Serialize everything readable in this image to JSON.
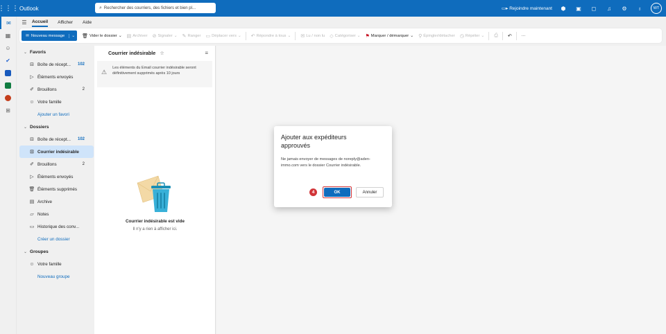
{
  "app": {
    "name": "Outlook"
  },
  "search": {
    "placeholder": "Rechercher des courriers, des fichiers et bien pl..."
  },
  "topbar": {
    "join_label": "Rejoindre maintenant",
    "avatar_initials": "WT"
  },
  "tabs": [
    {
      "label": "Accueil",
      "active": true
    },
    {
      "label": "Afficher",
      "active": false
    },
    {
      "label": "Aide",
      "active": false
    }
  ],
  "ribbon": {
    "new_message": "Nouveau message",
    "empty_folder": "Vider le dossier",
    "archive": "Archiver",
    "report": "Signaler",
    "sweep": "Ranger",
    "move_to": "Déplacer vers",
    "reply_all": "Répondre à tous",
    "read_unread": "Lu / non lu",
    "categorize": "Catégoriser",
    "flag": "Marquer / démarquer",
    "pin": "Épingler/détacher",
    "snooze": "Répéter",
    "more": "···"
  },
  "folders": {
    "favorites_title": "Favoris",
    "favorites": [
      {
        "label": "Boîte de récept...",
        "count": "102",
        "count_style": "blue",
        "icon": "inbox-icon"
      },
      {
        "label": "Éléments envoyés",
        "count": "",
        "icon": "send-icon"
      },
      {
        "label": "Brouillons",
        "count": "2",
        "count_style": "gray",
        "icon": "draft-icon"
      },
      {
        "label": "Votre famille",
        "count": "",
        "icon": "group-icon"
      }
    ],
    "add_favorite": "Ajouter un favori",
    "folders_title": "Dossiers",
    "items": [
      {
        "label": "Boîte de récept...",
        "count": "102",
        "count_style": "blue",
        "icon": "inbox-icon"
      },
      {
        "label": "Courrier indésirable",
        "count": "",
        "icon": "junk-icon",
        "selected": true
      },
      {
        "label": "Brouillons",
        "count": "2",
        "count_style": "gray",
        "icon": "draft-icon"
      },
      {
        "label": "Éléments envoyés",
        "count": "",
        "icon": "send-icon"
      },
      {
        "label": "Éléments supprimés",
        "count": "",
        "icon": "trash-icon"
      },
      {
        "label": "Archive",
        "count": "",
        "icon": "archive-icon"
      },
      {
        "label": "Notes",
        "count": "",
        "icon": "note-icon"
      },
      {
        "label": "Historique des conv...",
        "count": "",
        "icon": "folder-icon"
      }
    ],
    "create_folder": "Créer un dossier",
    "groups_title": "Groupes",
    "groups": [
      {
        "label": "Votre famille",
        "icon": "group-icon"
      }
    ],
    "new_group": "Nouveau groupe"
  },
  "message_list": {
    "title": "Courrier indésirable",
    "warning": "Les éléments du Email courrier indésirable seront définitivement supprimés après 10 jours",
    "empty_title": "Courrier indésirable est vide",
    "empty_subtitle": "Il n'y a rien à afficher ici."
  },
  "dialog": {
    "title": "Ajouter aux expéditeurs approuvés",
    "body": "Ne jamais envoyer de messages de noreply@aden-immo.com vers le dossier Courrier indésirable.",
    "ok_label": "OK",
    "cancel_label": "Annuler",
    "step_badge": "4"
  },
  "colors": {
    "accent": "#0f6cbd",
    "selected_bg": "#cfe4fa",
    "highlight": "#d13438"
  }
}
